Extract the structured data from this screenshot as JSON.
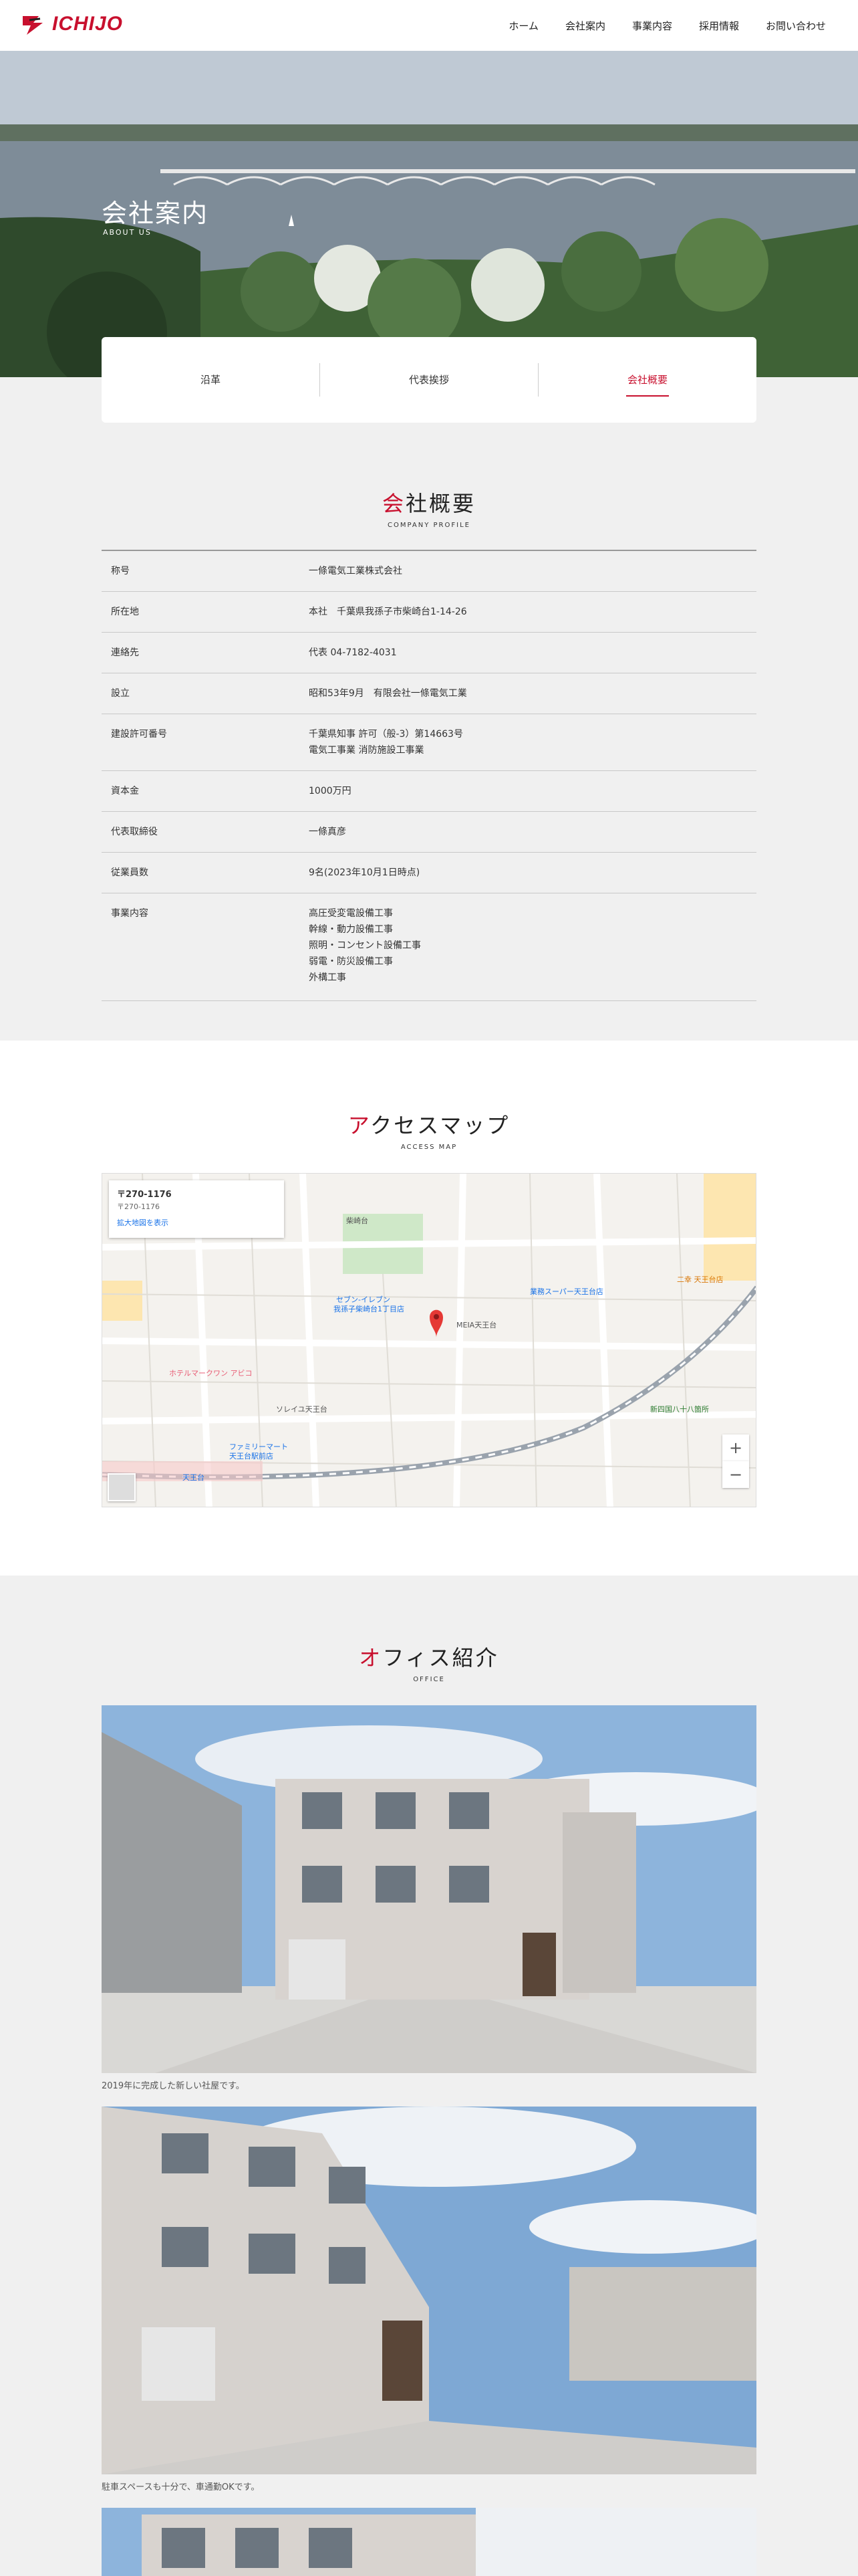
{
  "header": {
    "logo_text": "ICHIJO",
    "nav": [
      "ホーム",
      "会社案内",
      "事業内容",
      "採用情報",
      "お問い合わせ"
    ]
  },
  "hero": {
    "title": "会社案内",
    "subtitle": "ABOUT US"
  },
  "tabs": [
    {
      "label": "沿革"
    },
    {
      "label": "代表挨拶"
    },
    {
      "label": "会社概要"
    }
  ],
  "profile": {
    "title_first": "会",
    "title_rest": "社概要",
    "subtitle": "COMPANY PROFILE",
    "rows": [
      {
        "label": "称号",
        "lines": [
          "一條電気工業株式会社"
        ]
      },
      {
        "label": "所在地",
        "lines": [
          "本社　千葉県我孫子市柴崎台1-14-26"
        ]
      },
      {
        "label": "連絡先",
        "lines": [
          "代表 04-7182-4031"
        ]
      },
      {
        "label": "設立",
        "lines": [
          "昭和53年9月　有限会社一條電気工業"
        ]
      },
      {
        "label": "建設許可番号",
        "lines": [
          "千葉県知事 許可（般-3）第14663号",
          "電気工事業 消防施設工事業"
        ]
      },
      {
        "label": "資本金",
        "lines": [
          "1000万円"
        ]
      },
      {
        "label": "代表取締役",
        "lines": [
          "一條真彦"
        ]
      },
      {
        "label": "従業員数",
        "lines": [
          "9名(2023年10月1日時点)"
        ]
      },
      {
        "label": "事業内容",
        "lines": [
          "高圧受変電設備工事",
          "幹線・動力設備工事",
          "照明・コンセント設備工事",
          "弱電・防災設備工事",
          "外構工事"
        ]
      }
    ]
  },
  "access": {
    "title_first": "ア",
    "title_rest": "クセスマップ",
    "subtitle": "ACCESS MAP",
    "map": {
      "info_title": "〒270-1176",
      "info_sub": "〒270-1176",
      "info_link": "拡大地図を表示",
      "zoom_in": "+",
      "zoom_out": "−",
      "labels": [
        "柴崎台",
        "セブン-イレブン",
        "我孫子柴崎台1丁目店",
        "業務スーパー天王台店",
        "ホテルマークワン アビコ",
        "ファミリーマート",
        "天王台駅前店",
        "二幸 天王台店",
        "MEIA天王台",
        "天王台",
        "新四国八十八箇所",
        "ソレイユ天王台"
      ]
    }
  },
  "office": {
    "title_first": "オ",
    "title_rest": "フィス紹介",
    "subtitle": "OFFICE",
    "photos": [
      {
        "caption": "2019年に完成した新しい社屋です。"
      },
      {
        "caption": "駐車スペースも十分で、車通勤OKです。"
      },
      {
        "caption": ""
      }
    ]
  },
  "colors": {
    "accent": "#c8102e",
    "band": "#ffffff",
    "bg": "#f0f0f0"
  }
}
